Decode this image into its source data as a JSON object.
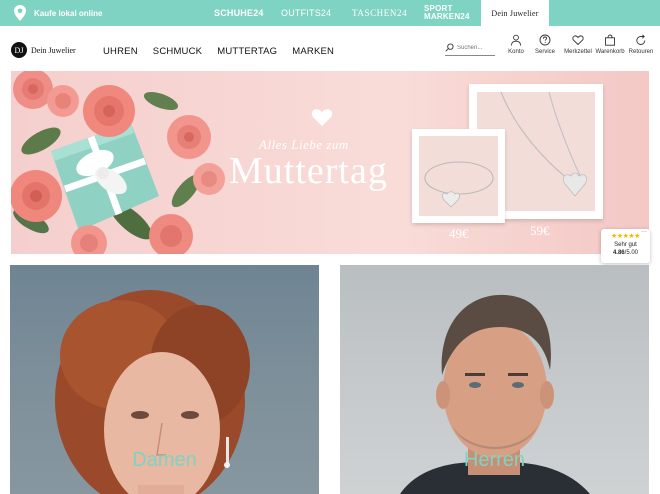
{
  "topbar": {
    "local_label": "Kaufe lokal online",
    "brands": [
      "SCHUHE24",
      "OUTFITS24",
      "TASCHEN24",
      "SPORT MARKEN24",
      "Dein Juwelier"
    ],
    "sport_line1": "SPORT",
    "sport_line2": "MARKEN24",
    "active_brand": "Dein Juwelier",
    "accent_color": "#7fd3c2"
  },
  "header": {
    "logo_text": "Dein Juwelier",
    "logo_mark": "DJ",
    "nav": [
      "UHREN",
      "SCHMUCK",
      "MUTTERTAG",
      "MARKEN"
    ],
    "search_placeholder": "Suchen...",
    "utilities": [
      {
        "label": "Konto",
        "icon": "user-icon"
      },
      {
        "label": "Service",
        "icon": "help-icon"
      },
      {
        "label": "Merkzettel",
        "icon": "heart-icon"
      },
      {
        "label": "Warenkorb",
        "icon": "bag-icon"
      },
      {
        "label": "Retouren",
        "icon": "return-icon"
      }
    ]
  },
  "hero": {
    "subtitle": "Alles Liebe zum",
    "title": "Muttertag",
    "price_bracelet": "49€",
    "price_necklace": "59€"
  },
  "rating": {
    "stars": "★★★★★",
    "grade": "Sehr gut",
    "score": "4.86",
    "max": "/5.00",
    "menu": "···"
  },
  "categories": [
    {
      "label": "Damen"
    },
    {
      "label": "Herren"
    }
  ]
}
